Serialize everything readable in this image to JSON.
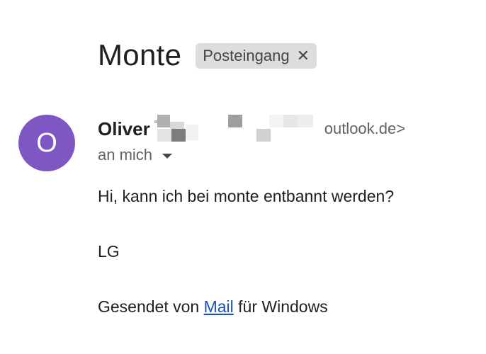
{
  "email": {
    "subject": "Monte",
    "label": "Posteingang",
    "label_close_icon": "close-icon",
    "avatar_letter": "O",
    "avatar_color": "#7e57c2",
    "sender_name": "Oliver",
    "sender_email_visible": "outlook.de>",
    "recipient": "an mich",
    "recipient_caret_icon": "caret-down-icon",
    "body": {
      "greeting": "Hi, kann ich bei monte entbannt werden?",
      "closing": "LG",
      "signature_prefix": "Gesendet von ",
      "signature_link": "Mail",
      "signature_suffix": " für Windows",
      "link_color": "#1a4fba"
    }
  }
}
